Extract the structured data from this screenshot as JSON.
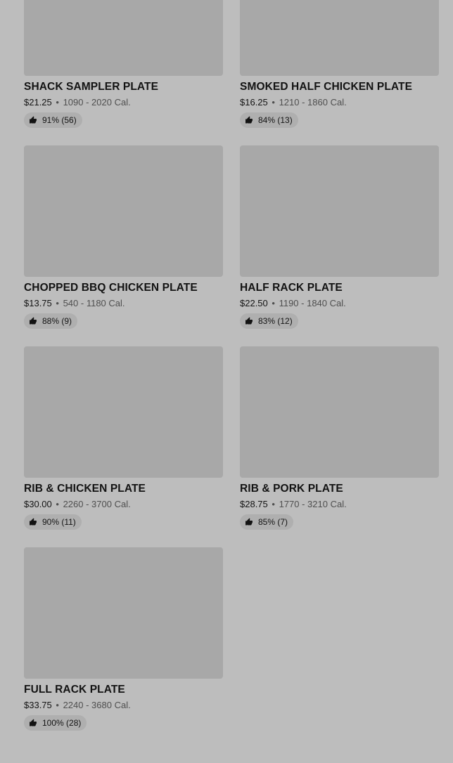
{
  "menu": {
    "items": [
      {
        "name": "SHACK SAMPLER PLATE",
        "price": "$21.25",
        "calories": "1090 - 2020 Cal.",
        "rating": "91% (56)"
      },
      {
        "name": "SMOKED HALF CHICKEN PLATE",
        "price": "$16.25",
        "calories": "1210 - 1860 Cal.",
        "rating": "84% (13)"
      },
      {
        "name": "CHOPPED BBQ CHICKEN PLATE",
        "price": "$13.75",
        "calories": "540 - 1180 Cal.",
        "rating": "88% (9)"
      },
      {
        "name": "HALF RACK PLATE",
        "price": "$22.50",
        "calories": "1190 - 1840 Cal.",
        "rating": "83% (12)"
      },
      {
        "name": "RIB & CHICKEN PLATE",
        "price": "$30.00",
        "calories": "2260 - 3700 Cal.",
        "rating": "90% (11)"
      },
      {
        "name": "RIB & PORK PLATE",
        "price": "$28.75",
        "calories": "1770 - 3210 Cal.",
        "rating": "85% (7)"
      },
      {
        "name": "FULL RACK PLATE",
        "price": "$33.75",
        "calories": "2240 - 3680 Cal.",
        "rating": "100% (28)"
      }
    ],
    "separator": "•",
    "rating_icon": "thumbs-up-icon"
  }
}
